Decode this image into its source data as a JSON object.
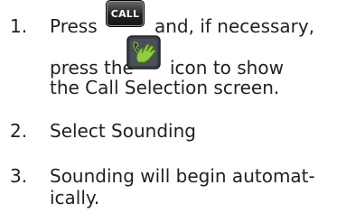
{
  "steps": [
    {
      "number": "1.",
      "line1_a": "Press",
      "key_label": "CALL",
      "line1_b": "and, if necessary,",
      "line2_a": "press the",
      "icon": "call-select-hand-icon",
      "line2_b": "icon to show",
      "line3": "the Call Selection screen."
    },
    {
      "number": "2.",
      "text": "Select Sounding"
    },
    {
      "number": "3.",
      "line1": "Sounding will begin automat-",
      "line2": "ically."
    }
  ],
  "colors": {
    "text": "#231f20",
    "key_bg": "#222222",
    "icon_green": "#8fcf3c",
    "icon_frame": "#3a3f45"
  }
}
